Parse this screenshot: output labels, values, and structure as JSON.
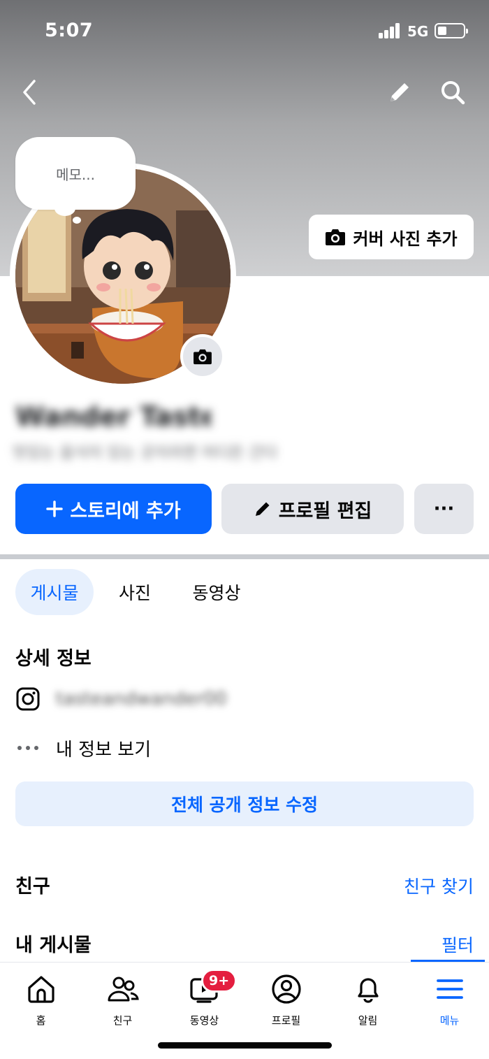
{
  "status_bar": {
    "time": "5:07",
    "network": "5G",
    "battery_level": 0.3
  },
  "cover": {
    "add_cover_label": "커버 사진 추가"
  },
  "memo": {
    "placeholder": "메모..."
  },
  "profile": {
    "name": "Wander Taste",
    "bio": "맛있는 음식이 있는 곳이라면 어디든 간다"
  },
  "actions": {
    "add_story": "스토리에 추가",
    "edit_profile": "프로필 편집",
    "more": "···"
  },
  "tabs": [
    {
      "label": "게시물",
      "active": true
    },
    {
      "label": "사진",
      "active": false
    },
    {
      "label": "동영상",
      "active": false
    }
  ],
  "details": {
    "title": "상세 정보",
    "instagram_handle": "tasteandwander00",
    "view_info": "내 정보 보기",
    "edit_public_info": "전체 공개 정보 수정"
  },
  "friends": {
    "title": "친구",
    "find_link": "친구 찾기"
  },
  "posts": {
    "title": "내 게시물",
    "filter_link": "필터"
  },
  "bottom_nav": {
    "items": [
      {
        "label": "홈",
        "icon": "home-icon"
      },
      {
        "label": "친구",
        "icon": "friends-icon"
      },
      {
        "label": "동영상",
        "icon": "video-icon"
      },
      {
        "label": "프로필",
        "icon": "profile-icon"
      },
      {
        "label": "알림",
        "icon": "bell-icon"
      },
      {
        "label": "메뉴",
        "icon": "menu-icon"
      }
    ],
    "video_badge": "9+",
    "active_index": 5
  },
  "colors": {
    "accent": "#0866ff",
    "badge": "#e41e3f",
    "secondary_button": "#e4e6eb"
  }
}
